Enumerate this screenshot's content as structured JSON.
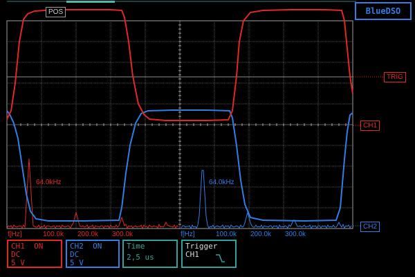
{
  "app": {
    "title": "BlueDSO"
  },
  "graticule": {
    "pos_label": "POS"
  },
  "markers": {
    "trig_label": "TRIG",
    "ch1_label": "CH1",
    "ch2_label": "CH2"
  },
  "fft": {
    "axis_unit": "f[Hz]",
    "ticks": [
      "100.0k",
      "200.0k",
      "300.0k"
    ],
    "ch1_peak_label": "64.0kHz",
    "ch2_peak_label": "64.0kHz"
  },
  "channels": [
    {
      "name": "CH1",
      "state": "ON",
      "coupling": "DC",
      "scale": "5 V",
      "color": "#e32626"
    },
    {
      "name": "CH2",
      "state": "ON",
      "coupling": "DC",
      "scale": "5 V",
      "color": "#2f7fe6"
    }
  ],
  "timebase": {
    "label": "Time",
    "value": "2,5 us",
    "color": "#2fa49d"
  },
  "trigger": {
    "label": "Trigger",
    "source": "CH1",
    "slope_icon": "falling-edge-icon"
  },
  "colors": {
    "grid": "#aaaaaa",
    "ch1": "#e32626",
    "ch2": "#2f7fe6",
    "accent": "#2fa49d"
  }
}
